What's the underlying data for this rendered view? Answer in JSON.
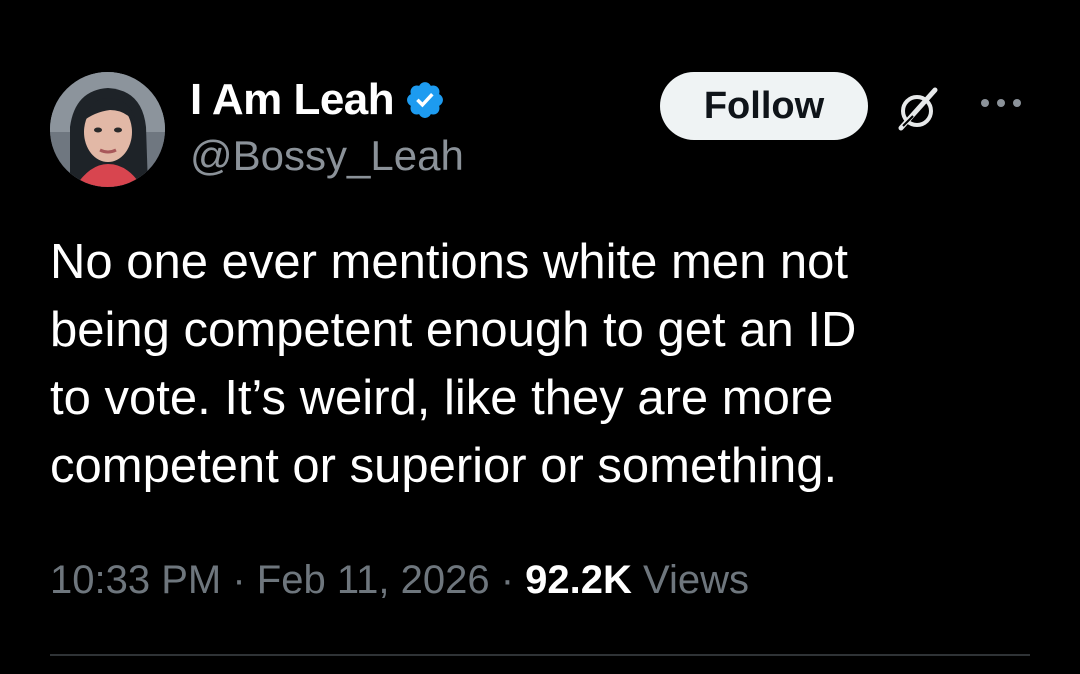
{
  "author": {
    "display_name": "I Am Leah",
    "handle": "@Bossy_Leah",
    "verified": true,
    "verified_color": "#1d9bf0"
  },
  "actions": {
    "follow_label": "Follow",
    "grok_icon": "grok-icon",
    "more_icon": "more-icon"
  },
  "tweet": {
    "text_lines": [
      "No one ever mentions white men not",
      "being competent enough to get an ID",
      "to vote. It’s weird, like they are more",
      "competent or superior or something."
    ]
  },
  "meta": {
    "time": "10:33 PM",
    "separator": "·",
    "date": "Feb 11, 2026",
    "views_count": "92.2K",
    "views_label": "Views"
  },
  "colors": {
    "background": "#000000",
    "text": "#ffffff",
    "muted": "#6e767d",
    "follow_bg": "#eff3f4"
  }
}
